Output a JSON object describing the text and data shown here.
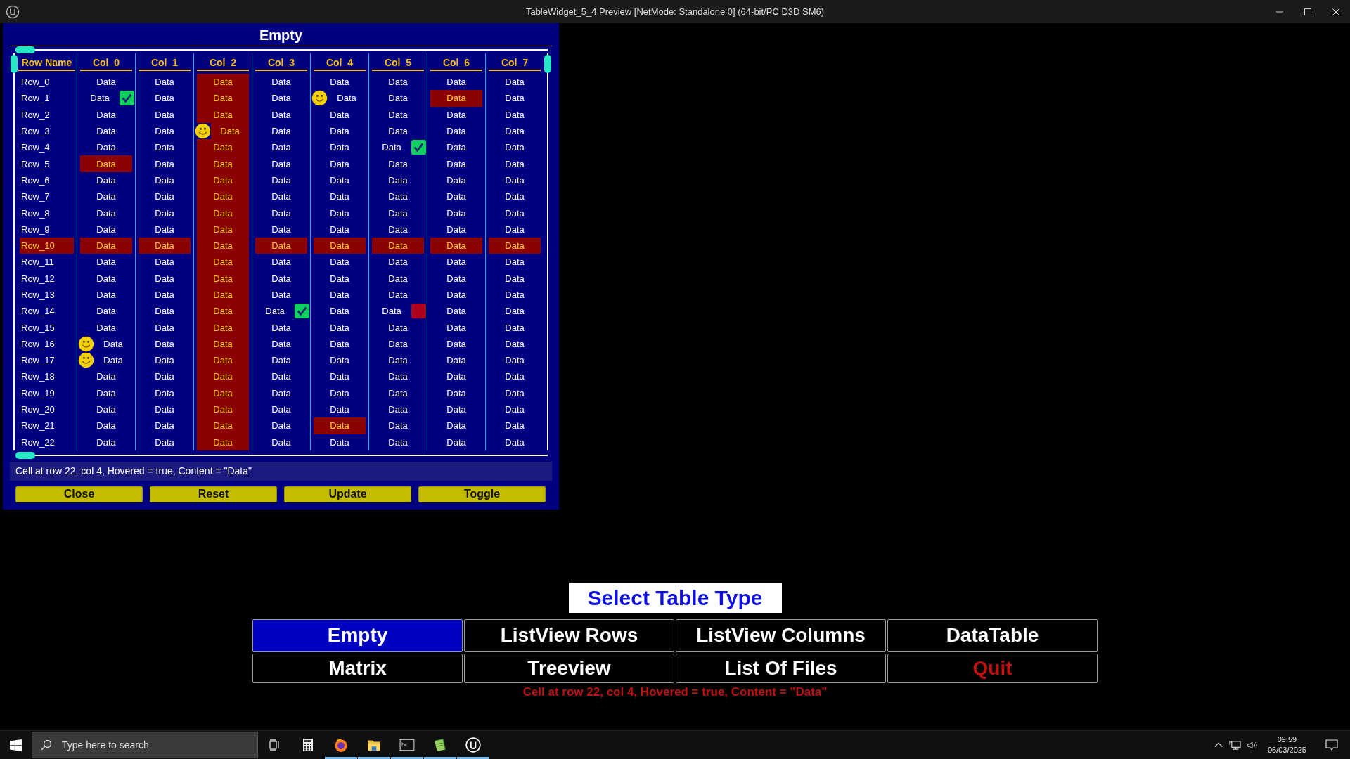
{
  "window": {
    "title": "TableWidget_5_4 Preview [NetMode: Standalone 0]  (64-bit/PC D3D SM6)"
  },
  "table_panel": {
    "title": "Empty",
    "columns": [
      "Row Name",
      "Col_0",
      "Col_1",
      "Col_2",
      "Col_3",
      "Col_4",
      "Col_5",
      "Col_6",
      "Col_7"
    ],
    "rows": [
      {
        "cells": [
          {
            "text": "Row_0",
            "highlighted": false
          },
          {
            "text": "Data",
            "highlighted": false
          },
          {
            "text": "Data",
            "highlighted": false
          },
          {
            "text": "Data",
            "highlighted": true
          },
          {
            "text": "Data",
            "highlighted": false
          },
          {
            "text": "Data",
            "highlighted": false
          },
          {
            "text": "Data",
            "highlighted": false
          },
          {
            "text": "Data",
            "highlighted": false
          },
          {
            "text": "Data",
            "highlighted": false
          }
        ]
      },
      {
        "cells": [
          {
            "text": "Row_1",
            "highlighted": false
          },
          {
            "text": "Data",
            "highlighted": false,
            "overlay": {
              "kind": "checkbox",
              "checked": true
            }
          },
          {
            "text": "Data",
            "highlighted": false
          },
          {
            "text": "Data",
            "highlighted": true
          },
          {
            "text": "Data",
            "highlighted": false
          },
          {
            "text": "Data",
            "highlighted": false,
            "overlay": {
              "kind": "smiley"
            }
          },
          {
            "text": "Data",
            "highlighted": false
          },
          {
            "text": "Data",
            "highlighted": true
          },
          {
            "text": "Data",
            "highlighted": false
          }
        ]
      },
      {
        "cells": [
          {
            "text": "Row_2",
            "highlighted": false
          },
          {
            "text": "Data",
            "highlighted": false
          },
          {
            "text": "Data",
            "highlighted": false
          },
          {
            "text": "Data",
            "highlighted": true
          },
          {
            "text": "Data",
            "highlighted": false
          },
          {
            "text": "Data",
            "highlighted": false
          },
          {
            "text": "Data",
            "highlighted": false
          },
          {
            "text": "Data",
            "highlighted": false
          },
          {
            "text": "Data",
            "highlighted": false
          }
        ]
      },
      {
        "cells": [
          {
            "text": "Row_3",
            "highlighted": false
          },
          {
            "text": "Data",
            "highlighted": false
          },
          {
            "text": "Data",
            "highlighted": false
          },
          {
            "text": "Data",
            "highlighted": true,
            "overlay": {
              "kind": "smiley"
            }
          },
          {
            "text": "Data",
            "highlighted": false
          },
          {
            "text": "Data",
            "highlighted": false
          },
          {
            "text": "Data",
            "highlighted": false
          },
          {
            "text": "Data",
            "highlighted": false
          },
          {
            "text": "Data",
            "highlighted": false
          }
        ]
      },
      {
        "cells": [
          {
            "text": "Row_4",
            "highlighted": false
          },
          {
            "text": "Data",
            "highlighted": false
          },
          {
            "text": "Data",
            "highlighted": false
          },
          {
            "text": "Data",
            "highlighted": true
          },
          {
            "text": "Data",
            "highlighted": false
          },
          {
            "text": "Data",
            "highlighted": false
          },
          {
            "text": "Data",
            "highlighted": false,
            "overlay": {
              "kind": "checkbox",
              "checked": true
            }
          },
          {
            "text": "Data",
            "highlighted": false
          },
          {
            "text": "Data",
            "highlighted": false
          }
        ]
      },
      {
        "cells": [
          {
            "text": "Row_5",
            "highlighted": false
          },
          {
            "text": "Data",
            "highlighted": true
          },
          {
            "text": "Data",
            "highlighted": false
          },
          {
            "text": "Data",
            "highlighted": true
          },
          {
            "text": "Data",
            "highlighted": false
          },
          {
            "text": "Data",
            "highlighted": false
          },
          {
            "text": "Data",
            "highlighted": false
          },
          {
            "text": "Data",
            "highlighted": false
          },
          {
            "text": "Data",
            "highlighted": false
          }
        ]
      },
      {
        "cells": [
          {
            "text": "Row_6",
            "highlighted": false
          },
          {
            "text": "Data",
            "highlighted": false
          },
          {
            "text": "Data",
            "highlighted": false
          },
          {
            "text": "Data",
            "highlighted": true
          },
          {
            "text": "Data",
            "highlighted": false
          },
          {
            "text": "Data",
            "highlighted": false
          },
          {
            "text": "Data",
            "highlighted": false
          },
          {
            "text": "Data",
            "highlighted": false
          },
          {
            "text": "Data",
            "highlighted": false
          }
        ]
      },
      {
        "cells": [
          {
            "text": "Row_7",
            "highlighted": false
          },
          {
            "text": "Data",
            "highlighted": false
          },
          {
            "text": "Data",
            "highlighted": false
          },
          {
            "text": "Data",
            "highlighted": true
          },
          {
            "text": "Data",
            "highlighted": false
          },
          {
            "text": "Data",
            "highlighted": false
          },
          {
            "text": "Data",
            "highlighted": false
          },
          {
            "text": "Data",
            "highlighted": false
          },
          {
            "text": "Data",
            "highlighted": false
          }
        ]
      },
      {
        "cells": [
          {
            "text": "Row_8",
            "highlighted": false
          },
          {
            "text": "Data",
            "highlighted": false
          },
          {
            "text": "Data",
            "highlighted": false
          },
          {
            "text": "Data",
            "highlighted": true
          },
          {
            "text": "Data",
            "highlighted": false
          },
          {
            "text": "Data",
            "highlighted": false
          },
          {
            "text": "Data",
            "highlighted": false
          },
          {
            "text": "Data",
            "highlighted": false
          },
          {
            "text": "Data",
            "highlighted": false
          }
        ]
      },
      {
        "cells": [
          {
            "text": "Row_9",
            "highlighted": false
          },
          {
            "text": "Data",
            "highlighted": false
          },
          {
            "text": "Data",
            "highlighted": false
          },
          {
            "text": "Data",
            "highlighted": true
          },
          {
            "text": "Data",
            "highlighted": false
          },
          {
            "text": "Data",
            "highlighted": false
          },
          {
            "text": "Data",
            "highlighted": false
          },
          {
            "text": "Data",
            "highlighted": false
          },
          {
            "text": "Data",
            "highlighted": false
          }
        ]
      },
      {
        "cells": [
          {
            "text": "Row_10",
            "highlighted": true
          },
          {
            "text": "Data",
            "highlighted": true
          },
          {
            "text": "Data",
            "highlighted": true
          },
          {
            "text": "Data",
            "highlighted": true
          },
          {
            "text": "Data",
            "highlighted": true
          },
          {
            "text": "Data",
            "highlighted": true
          },
          {
            "text": "Data",
            "highlighted": true
          },
          {
            "text": "Data",
            "highlighted": true
          },
          {
            "text": "Data",
            "highlighted": true
          }
        ]
      },
      {
        "cells": [
          {
            "text": "Row_11",
            "highlighted": false
          },
          {
            "text": "Data",
            "highlighted": false
          },
          {
            "text": "Data",
            "highlighted": false
          },
          {
            "text": "Data",
            "highlighted": true
          },
          {
            "text": "Data",
            "highlighted": false
          },
          {
            "text": "Data",
            "highlighted": false
          },
          {
            "text": "Data",
            "highlighted": false
          },
          {
            "text": "Data",
            "highlighted": false
          },
          {
            "text": "Data",
            "highlighted": false
          }
        ]
      },
      {
        "cells": [
          {
            "text": "Row_12",
            "highlighted": false
          },
          {
            "text": "Data",
            "highlighted": false
          },
          {
            "text": "Data",
            "highlighted": false
          },
          {
            "text": "Data",
            "highlighted": true
          },
          {
            "text": "Data",
            "highlighted": false
          },
          {
            "text": "Data",
            "highlighted": false
          },
          {
            "text": "Data",
            "highlighted": false
          },
          {
            "text": "Data",
            "highlighted": false
          },
          {
            "text": "Data",
            "highlighted": false
          }
        ]
      },
      {
        "cells": [
          {
            "text": "Row_13",
            "highlighted": false
          },
          {
            "text": "Data",
            "highlighted": false
          },
          {
            "text": "Data",
            "highlighted": false
          },
          {
            "text": "Data",
            "highlighted": true
          },
          {
            "text": "Data",
            "highlighted": false
          },
          {
            "text": "Data",
            "highlighted": false
          },
          {
            "text": "Data",
            "highlighted": false
          },
          {
            "text": "Data",
            "highlighted": false
          },
          {
            "text": "Data",
            "highlighted": false
          }
        ]
      },
      {
        "cells": [
          {
            "text": "Row_14",
            "highlighted": false
          },
          {
            "text": "Data",
            "highlighted": false
          },
          {
            "text": "Data",
            "highlighted": false
          },
          {
            "text": "Data",
            "highlighted": true
          },
          {
            "text": "Data",
            "highlighted": false,
            "overlay": {
              "kind": "checkbox",
              "checked": true
            }
          },
          {
            "text": "Data",
            "highlighted": false
          },
          {
            "text": "Data",
            "highlighted": false,
            "overlay": {
              "kind": "checkbox",
              "checked": false
            }
          },
          {
            "text": "Data",
            "highlighted": false
          },
          {
            "text": "Data",
            "highlighted": false
          }
        ]
      },
      {
        "cells": [
          {
            "text": "Row_15",
            "highlighted": false
          },
          {
            "text": "Data",
            "highlighted": false
          },
          {
            "text": "Data",
            "highlighted": false
          },
          {
            "text": "Data",
            "highlighted": true
          },
          {
            "text": "Data",
            "highlighted": false
          },
          {
            "text": "Data",
            "highlighted": false
          },
          {
            "text": "Data",
            "highlighted": false
          },
          {
            "text": "Data",
            "highlighted": false
          },
          {
            "text": "Data",
            "highlighted": false
          }
        ]
      },
      {
        "cells": [
          {
            "text": "Row_16",
            "highlighted": false
          },
          {
            "text": "Data",
            "highlighted": false,
            "overlay": {
              "kind": "smiley"
            }
          },
          {
            "text": "Data",
            "highlighted": false
          },
          {
            "text": "Data",
            "highlighted": true
          },
          {
            "text": "Data",
            "highlighted": false
          },
          {
            "text": "Data",
            "highlighted": false
          },
          {
            "text": "Data",
            "highlighted": false
          },
          {
            "text": "Data",
            "highlighted": false
          },
          {
            "text": "Data",
            "highlighted": false
          }
        ]
      },
      {
        "cells": [
          {
            "text": "Row_17",
            "highlighted": false
          },
          {
            "text": "Data",
            "highlighted": false,
            "overlay": {
              "kind": "smiley"
            }
          },
          {
            "text": "Data",
            "highlighted": false
          },
          {
            "text": "Data",
            "highlighted": true
          },
          {
            "text": "Data",
            "highlighted": false
          },
          {
            "text": "Data",
            "highlighted": false
          },
          {
            "text": "Data",
            "highlighted": false
          },
          {
            "text": "Data",
            "highlighted": false
          },
          {
            "text": "Data",
            "highlighted": false
          }
        ]
      },
      {
        "cells": [
          {
            "text": "Row_18",
            "highlighted": false
          },
          {
            "text": "Data",
            "highlighted": false
          },
          {
            "text": "Data",
            "highlighted": false
          },
          {
            "text": "Data",
            "highlighted": true
          },
          {
            "text": "Data",
            "highlighted": false
          },
          {
            "text": "Data",
            "highlighted": false
          },
          {
            "text": "Data",
            "highlighted": false
          },
          {
            "text": "Data",
            "highlighted": false
          },
          {
            "text": "Data",
            "highlighted": false
          }
        ]
      },
      {
        "cells": [
          {
            "text": "Row_19",
            "highlighted": false
          },
          {
            "text": "Data",
            "highlighted": false
          },
          {
            "text": "Data",
            "highlighted": false
          },
          {
            "text": "Data",
            "highlighted": true
          },
          {
            "text": "Data",
            "highlighted": false
          },
          {
            "text": "Data",
            "highlighted": false
          },
          {
            "text": "Data",
            "highlighted": false
          },
          {
            "text": "Data",
            "highlighted": false
          },
          {
            "text": "Data",
            "highlighted": false
          }
        ]
      },
      {
        "cells": [
          {
            "text": "Row_20",
            "highlighted": false
          },
          {
            "text": "Data",
            "highlighted": false
          },
          {
            "text": "Data",
            "highlighted": false
          },
          {
            "text": "Data",
            "highlighted": true
          },
          {
            "text": "Data",
            "highlighted": false
          },
          {
            "text": "Data",
            "highlighted": false
          },
          {
            "text": "Data",
            "highlighted": false
          },
          {
            "text": "Data",
            "highlighted": false
          },
          {
            "text": "Data",
            "highlighted": false
          }
        ]
      },
      {
        "cells": [
          {
            "text": "Row_21",
            "highlighted": false
          },
          {
            "text": "Data",
            "highlighted": false
          },
          {
            "text": "Data",
            "highlighted": false
          },
          {
            "text": "Data",
            "highlighted": true
          },
          {
            "text": "Data",
            "highlighted": false
          },
          {
            "text": "Data",
            "highlighted": true
          },
          {
            "text": "Data",
            "highlighted": false
          },
          {
            "text": "Data",
            "highlighted": false
          },
          {
            "text": "Data",
            "highlighted": false
          }
        ]
      },
      {
        "cells": [
          {
            "text": "Row_22",
            "highlighted": false
          },
          {
            "text": "Data",
            "highlighted": false
          },
          {
            "text": "Data",
            "highlighted": false
          },
          {
            "text": "Data",
            "highlighted": true
          },
          {
            "text": "Data",
            "highlighted": false
          },
          {
            "text": "Data",
            "highlighted": false
          },
          {
            "text": "Data",
            "highlighted": false
          },
          {
            "text": "Data",
            "highlighted": false
          },
          {
            "text": "Data",
            "highlighted": false
          }
        ]
      }
    ],
    "status": "Cell at row 22,  col 4, Hovered = true, Content = \"Data\"",
    "buttons": [
      "Close",
      "Reset",
      "Update",
      "Toggle"
    ]
  },
  "table_type": {
    "heading": "Select Table Type",
    "options": [
      {
        "label": "Empty",
        "selected": true,
        "kind": "normal"
      },
      {
        "label": "ListView Rows",
        "selected": false,
        "kind": "normal"
      },
      {
        "label": "ListView Columns",
        "selected": false,
        "kind": "normal"
      },
      {
        "label": "DataTable",
        "selected": false,
        "kind": "normal"
      },
      {
        "label": "Matrix",
        "selected": false,
        "kind": "normal"
      },
      {
        "label": "Treeview",
        "selected": false,
        "kind": "normal"
      },
      {
        "label": "List Of Files",
        "selected": false,
        "kind": "normal"
      },
      {
        "label": "Quit",
        "selected": false,
        "kind": "danger"
      }
    ],
    "status": "Cell at row 22,  col 4, Hovered = true, Content = \"Data\""
  },
  "taskbar": {
    "search": {
      "placeholder": "Type here to search"
    },
    "apps": [
      {
        "kind": "task-view",
        "running": false
      },
      {
        "kind": "calculator",
        "running": false
      },
      {
        "kind": "browser",
        "running": true
      },
      {
        "kind": "explorer",
        "running": true
      },
      {
        "kind": "terminal",
        "running": true
      },
      {
        "kind": "notepad",
        "running": true
      },
      {
        "kind": "engine",
        "running": true
      }
    ],
    "clock": {
      "time": "09:59",
      "date": "06/03/2025"
    }
  }
}
